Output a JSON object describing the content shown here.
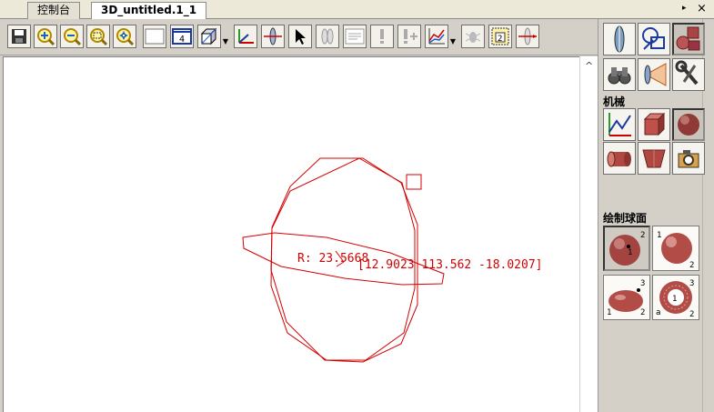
{
  "tabs": [
    {
      "label": "控制台",
      "active": false
    },
    {
      "label": "3D_untitled.1_1",
      "active": true
    }
  ],
  "tab_nav": {
    "left": "◂",
    "right": "▸",
    "close": "×"
  },
  "toolbar": {
    "buttons": [
      "save-icon",
      "zoom-in-icon",
      "zoom-out-icon",
      "zoom-fit-icon",
      "zoom-all-icon",
      "blank-frame-icon",
      "four-view-icon",
      "box-view-icon",
      "axes-icon",
      "lens-axis-icon",
      "select-arrow-icon",
      "double-lens-icon",
      "list-window-icon",
      "exclamation-icon",
      "exclamation-plus-icon",
      "chart-lines-icon",
      "bug-icon",
      "numbered-frame-icon",
      "lens-ray-icon"
    ],
    "four_view_label": "4",
    "numbered_frame_label": "2"
  },
  "viewport": {
    "radius_label": "R: 23.5668",
    "coords_label": "[12.9023 113.562 -18.0207]",
    "drawing_color": "#d40000"
  },
  "panel": {
    "mechanics_label": "机械",
    "sphere_label": "绘制球面",
    "sphere_buttons": [
      {
        "name": "sphere-center-radius",
        "marks": [
          "1",
          "2"
        ]
      },
      {
        "name": "sphere-two-points",
        "marks": [
          "1",
          "2"
        ]
      },
      {
        "name": "ellipsoid-three-points",
        "marks": [
          "1",
          "2",
          "3"
        ]
      },
      {
        "name": "torus-three-points",
        "marks": [
          "1",
          "2",
          "3",
          "a"
        ]
      }
    ]
  },
  "colors": {
    "chrome": "#d4d0c8",
    "canvas": "#ffffff",
    "accent_red": "#b84a4a"
  }
}
